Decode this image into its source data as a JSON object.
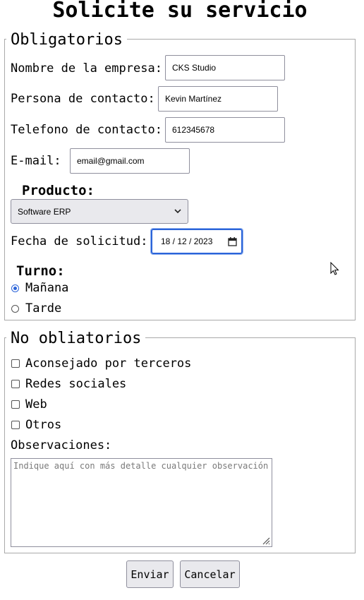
{
  "title": "Solicite su servicio",
  "required": {
    "legend": "Obligatorios",
    "company_label": "Nombre de la empresa:",
    "company_value": "CKS Studio",
    "contact_label": "Persona de contacto:",
    "contact_value": "Kevin Martínez",
    "phone_label": "Telefono de contacto:",
    "phone_value": "612345678",
    "email_label": "E-mail:",
    "email_value": "email@gmail.com",
    "product_label": "Producto:",
    "product_value": "Software ERP",
    "date_label": "Fecha de solicitud:",
    "date_value": "18 / 12 / 2023",
    "shift_label": "Turno:",
    "shift_options": [
      "Mañana",
      "Tarde"
    ],
    "shift_selected": "Mañana"
  },
  "optional": {
    "legend": "No obliatorios",
    "checkboxes": [
      "Aconsejado por terceros",
      "Redes sociales",
      "Web",
      "Otros"
    ],
    "notes_label": "Observaciones:",
    "notes_placeholder": "Indique aquí con más detalle cualquier observación"
  },
  "buttons": {
    "submit": "Enviar",
    "cancel": "Cancelar"
  },
  "icons": {
    "select_arrow": "chevron-down-icon",
    "date_picker": "calendar-icon",
    "textarea_resize": "resize-grip-icon",
    "cursor": "mouse-cursor-icon"
  },
  "colors": {
    "focus": "#2b64d9",
    "border": "#8f8f9d",
    "button_bg": "#e9e9ed"
  }
}
